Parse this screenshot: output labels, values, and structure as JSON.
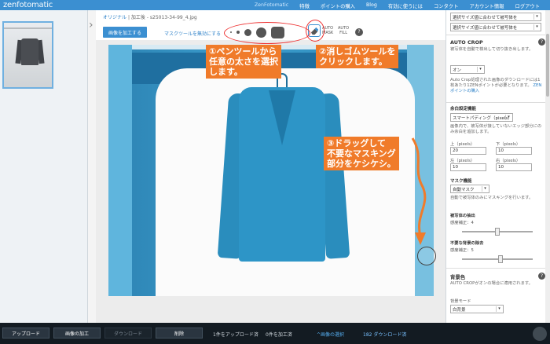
{
  "brand": {
    "logo_part1": "zen",
    "logo_part2": "fotomatic"
  },
  "nav": {
    "items": [
      "ZenFotomatic",
      "特徴",
      "ポイントの購入",
      "Blog",
      "有効に使うには",
      "コンタクト",
      "アカウント情報",
      "ログアウト"
    ],
    "active_index": 0
  },
  "editor": {
    "crumb_original": "オリジナル",
    "crumb_sep": "|",
    "crumb_processed": "加工後",
    "crumb_sep2": "-",
    "filename": "s25013-34-99_4.jpg",
    "process_button": "画像を加工する",
    "mask_disable": "マスクツールを無効にする",
    "auto_mask_1": "AUTO",
    "auto_mask_2": "MASK",
    "auto_fill_1": "AUTO",
    "auto_fill_2": "FILL",
    "help": "?",
    "collapse_icon": "›"
  },
  "annotations": {
    "step1_line1": "①ペンツールから",
    "step1_line2": "任意の太さを選択",
    "step1_line3": "します。",
    "step2_line1": "②消しゴムツールを",
    "step2_line2": "クリックします。",
    "step3_line1": "③ドラッグして",
    "step3_line2": "不要なマスキング",
    "step3_line3": "部分をケシケシ。",
    "accent": "#f07b2a",
    "ring_color": "#e33333"
  },
  "right_panel": {
    "select1": "選択サイズ値に合わせて被写体を",
    "select2": "選択サイズ値に合わせて被写体を",
    "auto_crop_title": "AUTO CROP",
    "auto_crop_desc": "被写体を自動で検出して切り抜き出します。",
    "auto_crop_value": "オン",
    "auto_crop_note_1": "Auto Crop処理された画像のダウンロードには1枚あたり1ZENポイントが必要となります。",
    "auto_crop_note_link": "ZENポイントの購入",
    "margin_title": "余白設定機能",
    "margin_value": "スマートパディング（pixels）",
    "margin_desc": "画像内で、被写体が接していないエッジ部分にのみ余白を追加します。",
    "top_label": "上（pixels）",
    "top_value": "20",
    "bottom_label": "下（pixels）",
    "bottom_value": "10",
    "left_label": "左（pixels）",
    "left_value": "10",
    "right_label": "右（pixels）",
    "right_value": "10",
    "mask_title": "マスク機能",
    "mask_value": "自動マスク",
    "mask_desc": "自動で被写体のみにマスキングを行います。",
    "subject_title": "被写体の抽出",
    "subject_label": "感度補正：4",
    "subject_level": 0.5,
    "unneeded_title": "不要な背景の除去",
    "unneeded_label": "感度補正：5",
    "unneeded_level": 0.55,
    "bg_title": "背景色",
    "bg_desc": "AUTO CROPがオンの場合に適用されます。",
    "bg_mode_label": "背景モード",
    "bg_mode_value": "白背景",
    "help": "?"
  },
  "bottom": {
    "upload": "アップロード",
    "process": "画像の加工",
    "download": "ダウンロード",
    "delete": "削除",
    "uploaded_count": "1件をアップロード済",
    "processed_count": "0件を加工済",
    "select_images": "^画像の選択",
    "downloaded_count": "182 ダウンロード済"
  }
}
